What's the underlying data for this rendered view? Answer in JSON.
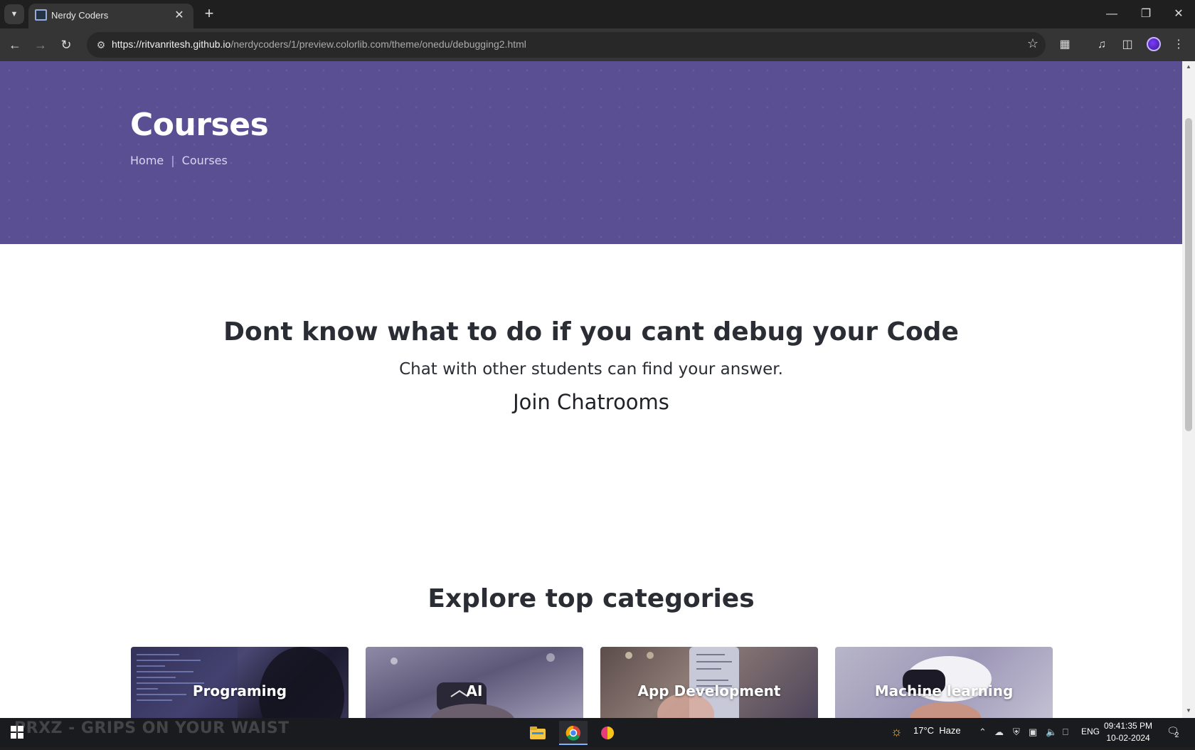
{
  "browser": {
    "tab_title": "Nerdy Coders",
    "url_host": "https://ritvanritesh.github.io",
    "url_path": "/nerdycoders/1/preview.colorlib.com/theme/onedu/debugging2.html"
  },
  "hero": {
    "title": "Courses",
    "breadcrumb_home": "Home",
    "breadcrumb_separator": "|",
    "breadcrumb_current": "Courses",
    "background_color": "#5a4f93"
  },
  "debug_section": {
    "heading": "Dont know what to do if you cant debug your Code",
    "subheading": "Chat with other students can find your answer.",
    "link": "Join Chatrooms"
  },
  "categories": {
    "heading": "Explore top categories",
    "items": [
      {
        "label": "Programing"
      },
      {
        "label": "AI"
      },
      {
        "label": "App Development"
      },
      {
        "label": "Machine learning"
      }
    ]
  },
  "taskbar": {
    "background_text": "PRXZ - GRIPS ON YOUR WAIST",
    "weather_temp": "17°C",
    "weather_desc": "Haze",
    "language": "ENG",
    "time": "09:41:35 PM",
    "date": "10-02-2024",
    "notification_count": "2"
  }
}
